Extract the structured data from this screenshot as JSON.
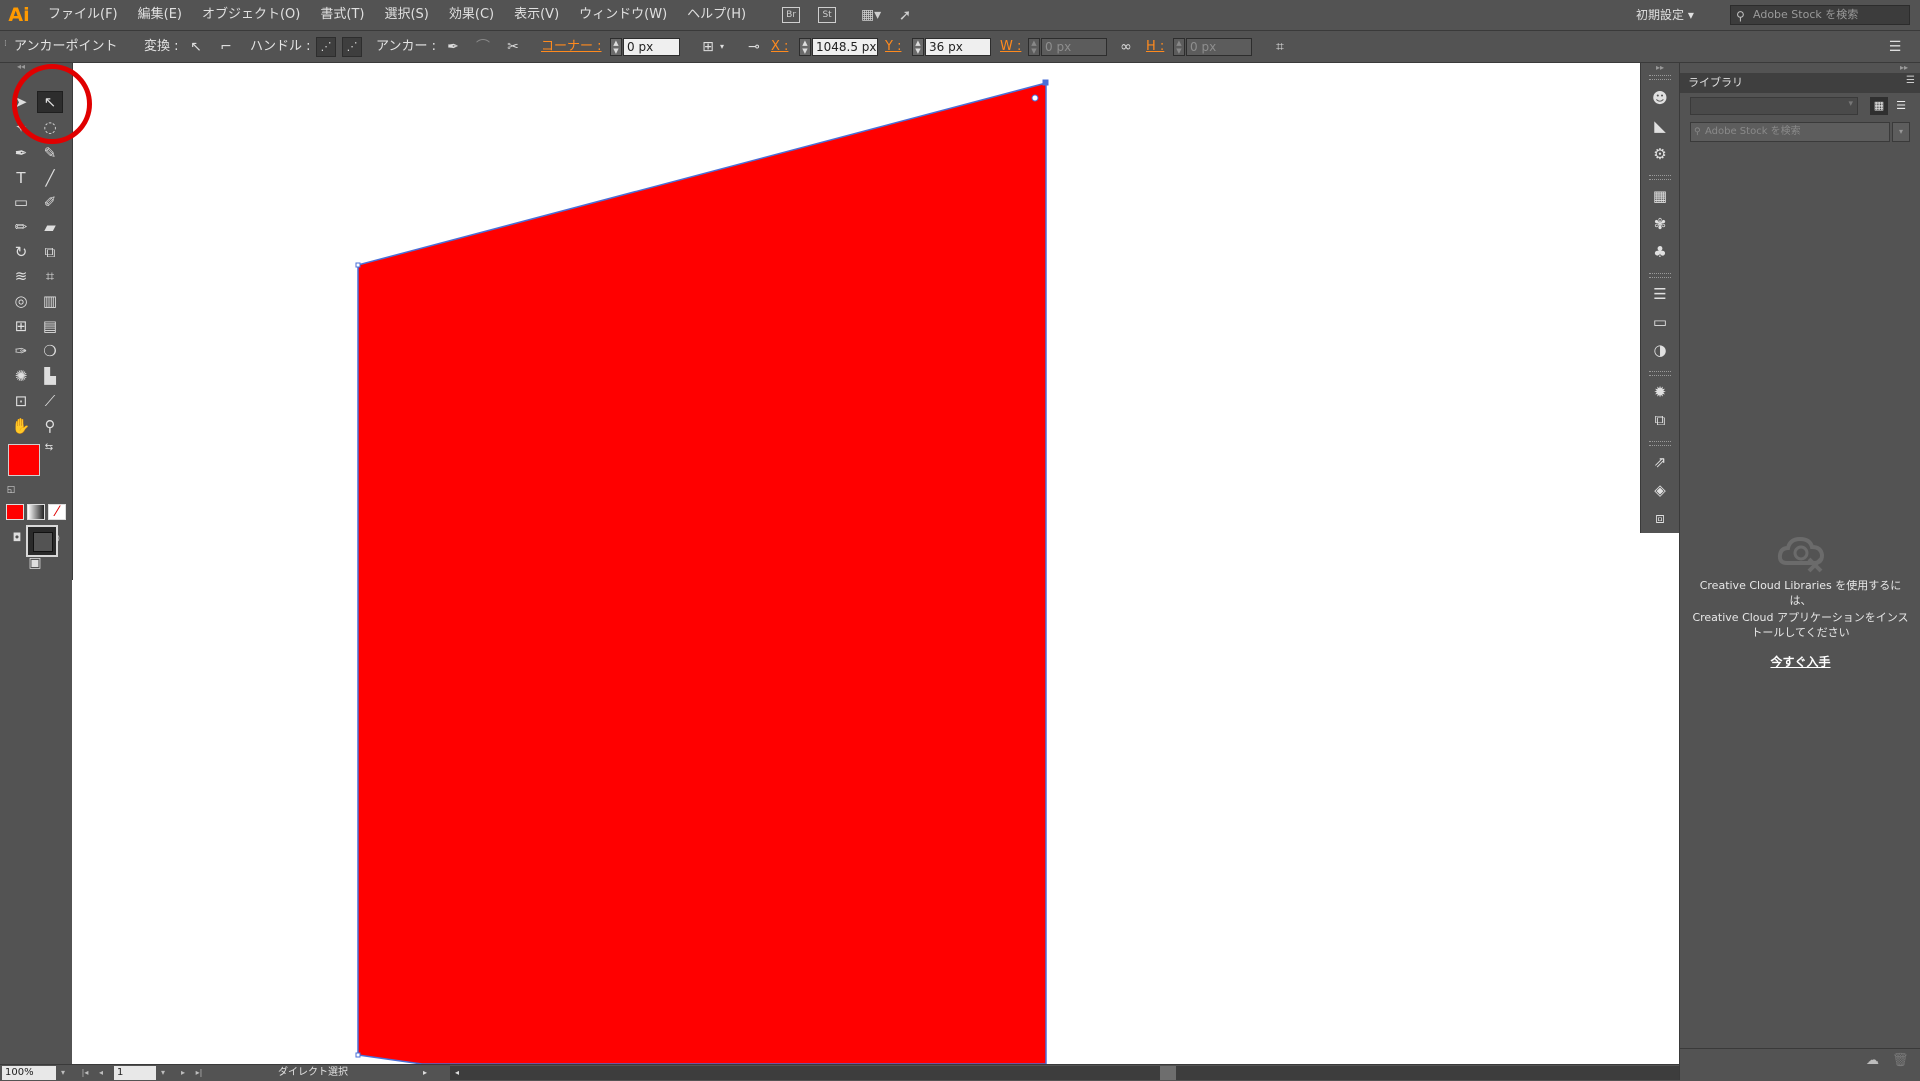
{
  "app": {
    "logo": "Ai"
  },
  "menu": [
    "ファイル(F)",
    "編集(E)",
    "オブジェクト(O)",
    "書式(T)",
    "選択(S)",
    "効果(C)",
    "表示(V)",
    "ウィンドウ(W)",
    "ヘルプ(H)"
  ],
  "menubar_icons": {
    "bridge": "Br",
    "stock": "St"
  },
  "workspace": {
    "label": "初期設定"
  },
  "stock_search": {
    "placeholder": "Adobe Stock を検索"
  },
  "controlbar": {
    "selection_label": "アンカーポイント",
    "convert_label": "変換 :",
    "handle_label": "ハンドル :",
    "anchor_label": "アンカー :",
    "corner_label": "コーナー :",
    "corner_value": "0 px",
    "x_label": "X :",
    "x_value": "1048.5 px",
    "y_label": "Y :",
    "y_value": "36 px",
    "w_label": "W :",
    "w_value": "0 px",
    "h_label": "H :",
    "h_value": "0 px"
  },
  "artwork": {
    "fill_color": "#ff0000",
    "path_color": "#4a6fd8"
  },
  "tools": {
    "active": "direct-selection-tool",
    "fill_color": "#ff0000"
  },
  "library": {
    "title": "ライブラリ",
    "search_placeholder": "Adobe Stock を検索",
    "message_line1": "Creative Cloud Libraries を使用するには、",
    "message_line2": "Creative Cloud アプリケーションをインストールしてください",
    "link": "今すぐ入手"
  },
  "status": {
    "zoom": "100%",
    "artboard": "1",
    "current_tool": "ダイレクト選択"
  }
}
